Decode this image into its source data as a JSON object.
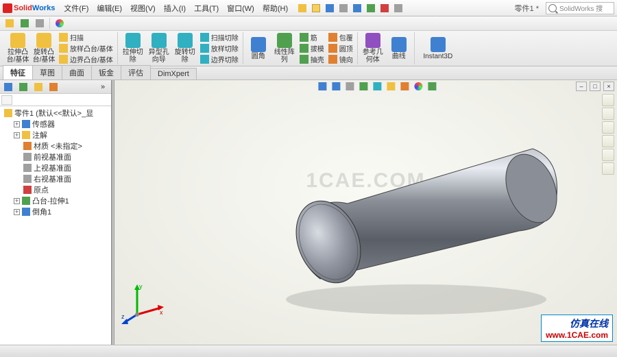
{
  "app": {
    "name_prefix": "Solid",
    "name_suffix": "Works",
    "search_placeholder": "SolidWorks 搜"
  },
  "document": {
    "title": "零件1 *"
  },
  "menu": {
    "file": "文件(F)",
    "edit": "编辑(E)",
    "view": "视图(V)",
    "insert": "插入(I)",
    "tools": "工具(T)",
    "window": "窗口(W)",
    "help": "帮助(H)"
  },
  "ribbon": {
    "group1": {
      "btn1": "拉伸凸台/基体",
      "btn2": "旋转凸台/基体"
    },
    "group1b": {
      "row1": "扫描",
      "row2": "放样凸台/基体",
      "row3": "边界凸台/基体"
    },
    "group2": {
      "btn1": "拉伸切除",
      "btn2": "异型孔向导",
      "btn3": "旋转切除"
    },
    "group2b": {
      "row1": "扫描切除",
      "row2": "放样切除",
      "row3": "边界切除"
    },
    "group3": {
      "btn1": "圆角",
      "btn2": "线性阵列"
    },
    "group3b": {
      "row1": "筋",
      "row2": "拔模",
      "row3": "抽壳"
    },
    "group3c": {
      "row1": "包覆",
      "row2": "圆顶",
      "row3": "镜向"
    },
    "group4": {
      "btn1": "参考几何体",
      "btn2": "曲线"
    },
    "group5": {
      "btn1": "Instant3D"
    }
  },
  "tabs": {
    "t1": "特征",
    "t2": "草图",
    "t3": "曲面",
    "t4": "钣金",
    "t5": "评估",
    "t6": "DimXpert"
  },
  "tree": {
    "root": "零件1 (默认<<默认>_显",
    "items": [
      {
        "label": "传感器"
      },
      {
        "label": "注解"
      },
      {
        "label": "材质 <未指定>"
      },
      {
        "label": "前视基准面"
      },
      {
        "label": "上视基准面"
      },
      {
        "label": "右视基准面"
      },
      {
        "label": "原点"
      },
      {
        "label": "凸台-拉伸1"
      },
      {
        "label": "倒角1"
      }
    ]
  },
  "triad": {
    "x": "x",
    "y": "y",
    "z": "z"
  },
  "watermark": "1CAE.COM",
  "branding": {
    "line1": "仿真在线",
    "line2": "www.1CAE.com"
  }
}
